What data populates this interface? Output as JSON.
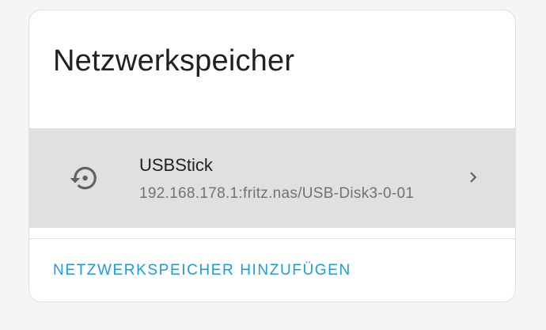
{
  "card": {
    "title": "Netzwerkspeicher"
  },
  "storage_items": [
    {
      "name": "USBStick",
      "path": "192.168.178.1:fritz.nas/USB-Disk3-0-01",
      "icon": "restore-icon"
    }
  ],
  "actions": {
    "add_label": "NETZWERKSPEICHER HINZUFÜGEN"
  },
  "colors": {
    "accent": "#1e9ae0",
    "row_highlight": "#e0e0e0",
    "icon": "#616161"
  }
}
